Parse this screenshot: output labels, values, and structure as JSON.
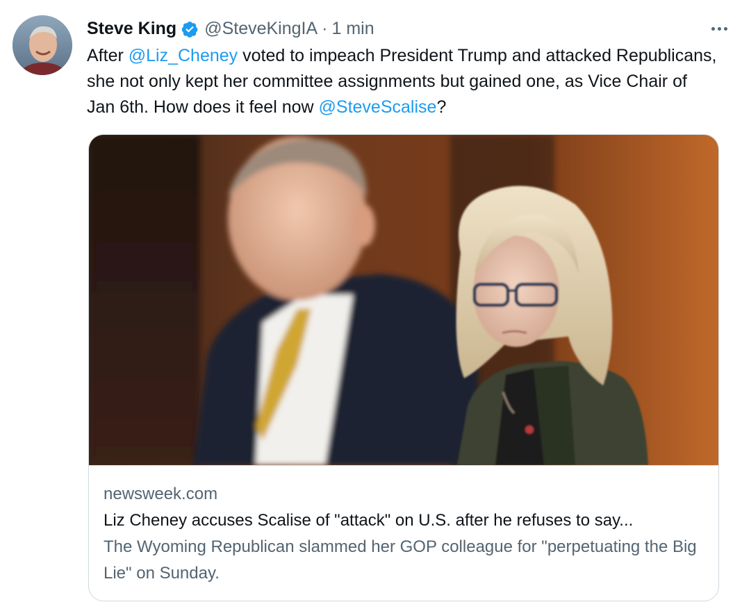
{
  "author": {
    "display_name": "Steve King",
    "handle": "@SteveKingIA",
    "separator": "·",
    "timestamp": "1 min",
    "verified": true,
    "verified_icon": "verified-badge-icon",
    "avatar_icon": "avatar"
  },
  "tweet": {
    "text_1": "After ",
    "mention_1": "@Liz_Cheney",
    "text_2": " voted to impeach President Trump and attacked Republicans, she not only kept her committee assignments but gained one, as Vice Chair of Jan 6th. How does it feel now ",
    "mention_2": "@SteveScalise",
    "text_3": "?"
  },
  "card": {
    "domain": "newsweek.com",
    "title": "Liz Cheney accuses Scalise of \"attack\" on U.S. after he refuses to say...",
    "description": "The Wyoming Republican slammed her GOP colleague for \"perpetuating the Big Lie\" on Sunday."
  },
  "colors": {
    "accent": "#1d9bf0",
    "secondary_text": "#536471",
    "primary_text": "#0f1419",
    "border": "#cfd9de"
  },
  "more_icon": "more-options-icon"
}
